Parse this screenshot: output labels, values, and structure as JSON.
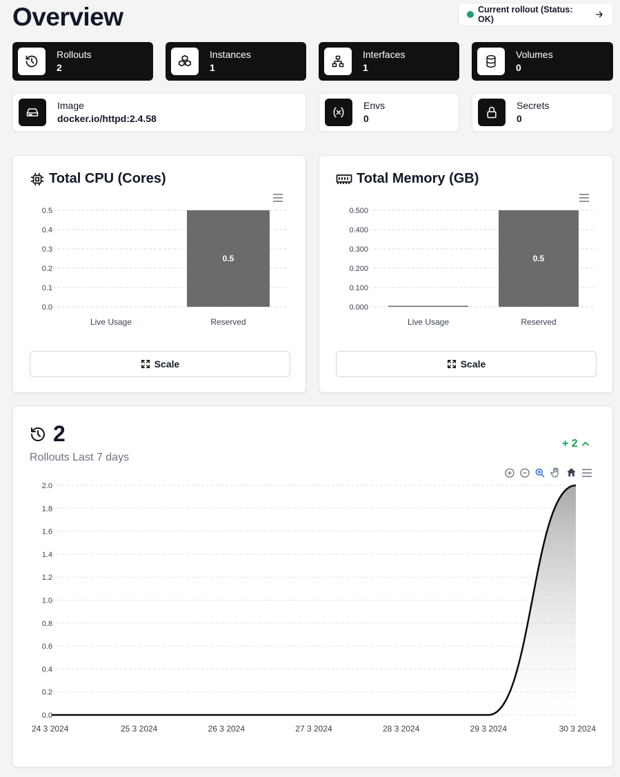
{
  "header": {
    "title": "Overview",
    "rollout_status": "Current rollout (Status: OK)"
  },
  "stats": [
    {
      "label": "Rollouts",
      "value": "2",
      "icon": "history-icon"
    },
    {
      "label": "Instances",
      "value": "1",
      "icon": "cubes-icon"
    },
    {
      "label": "Interfaces",
      "value": "1",
      "icon": "network-icon"
    },
    {
      "label": "Volumes",
      "value": "0",
      "icon": "database-icon"
    }
  ],
  "details": [
    {
      "label": "Image",
      "value": "docker.io/httpd:2.4.58",
      "icon": "hard-drive-icon"
    },
    {
      "label": "Envs",
      "value": "0",
      "icon": "variable-icon"
    },
    {
      "label": "Secrets",
      "value": "0",
      "icon": "lock-icon"
    }
  ],
  "cpu_panel": {
    "title": "Total CPU (Cores)",
    "scale_label": "Scale"
  },
  "memory_panel": {
    "title": "Total Memory (GB)",
    "scale_label": "Scale"
  },
  "rollouts_panel": {
    "count": "2",
    "subtitle": "Rollouts Last 7 days",
    "delta": "+ 2"
  },
  "colors": {
    "accent_dark": "#111111",
    "bar": "#6b6b6b",
    "status_ok": "#22a06b",
    "delta": "#16a34a"
  },
  "chart_data": [
    {
      "type": "bar",
      "title": "Total CPU (Cores)",
      "categories": [
        "Live Usage",
        "Reserved"
      ],
      "values": [
        0,
        0.5
      ],
      "data_labels": [
        "",
        "0.5"
      ],
      "yticks": [
        "0.0",
        "0.1",
        "0.2",
        "0.3",
        "0.4",
        "0.5"
      ],
      "ylim": [
        0,
        0.5
      ],
      "grid": true
    },
    {
      "type": "bar",
      "title": "Total Memory (GB)",
      "categories": [
        "Live Usage",
        "Reserved"
      ],
      "values": [
        0.003,
        0.5
      ],
      "data_labels": [
        "",
        "0.5"
      ],
      "yticks": [
        "0.000",
        "0.100",
        "0.200",
        "0.300",
        "0.400",
        "0.500"
      ],
      "ylim": [
        0,
        0.5
      ],
      "grid": true
    },
    {
      "type": "area",
      "title": "Rollouts Last 7 days",
      "x": [
        "24 3 2024",
        "25 3 2024",
        "26 3 2024",
        "27 3 2024",
        "28 3 2024",
        "29 3 2024",
        "30 3 2024"
      ],
      "values": [
        0,
        0,
        0,
        0,
        0,
        0,
        2
      ],
      "yticks": [
        "0.0",
        "0.2",
        "0.4",
        "0.6",
        "0.8",
        "1.0",
        "1.2",
        "1.4",
        "1.6",
        "1.8",
        "2.0"
      ],
      "ylim": [
        0,
        2
      ],
      "grid": true
    }
  ]
}
